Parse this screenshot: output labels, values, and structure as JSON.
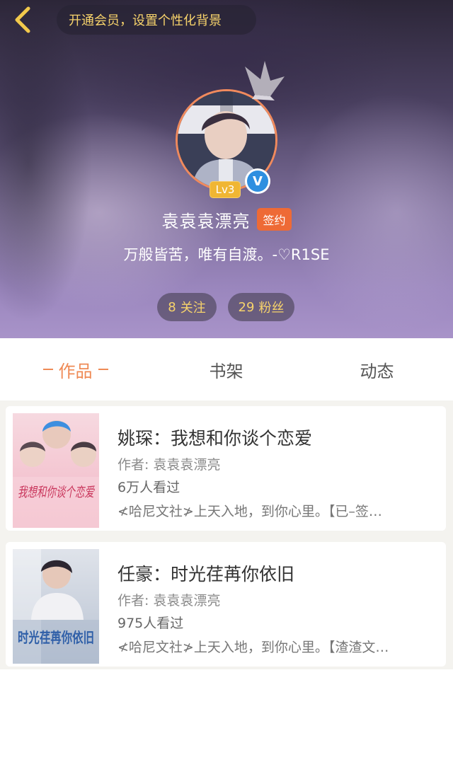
{
  "header": {
    "vip_banner": "开通会员，设置个性化背景",
    "level": "Lv3",
    "verified_mark": "V",
    "username": "袁袁袁漂亮",
    "sign_badge": "签约",
    "bio": "万般皆苦，唯有自渡。-♡R1SE",
    "following": {
      "count": "8",
      "label": "关注"
    },
    "fans": {
      "count": "29",
      "label": "粉丝"
    }
  },
  "tabs": [
    {
      "label": "作品",
      "active": true
    },
    {
      "label": "书架",
      "active": false
    },
    {
      "label": "动态",
      "active": false
    }
  ],
  "works": [
    {
      "title": "姚琛：我想和你谈个恋爱",
      "author": "作者: 袁袁袁漂亮",
      "views": "6万人看过",
      "description": "≮哈尼文社≯上天入地，到你心里。【已–签…",
      "cover_text": "我想和你谈个恋爱"
    },
    {
      "title": "任豪：时光荏苒你依旧",
      "author": "作者: 袁袁袁漂亮",
      "views": "975人看过",
      "description": "≮哈尼文社≯上天入地，到你心里。【渣渣文…",
      "cover_text": "时光荏苒你依旧"
    }
  ],
  "colors": {
    "accent_orange": "#ef8a55",
    "gold_text": "#f7d36b",
    "sign_badge_bg": "#ee6a36",
    "verified_blue": "#2e8fe0"
  }
}
